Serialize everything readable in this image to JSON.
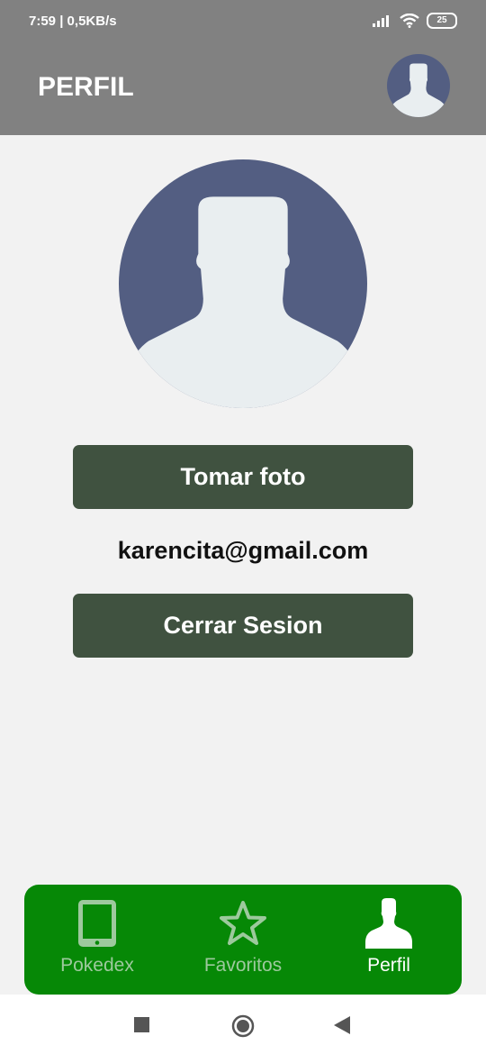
{
  "status_bar": {
    "time_speed": "7:59 | 0,5KB/s",
    "battery_level": "25"
  },
  "header": {
    "title": "PERFIL",
    "avatar_icon": "user-avatar-icon"
  },
  "profile": {
    "avatar_icon": "user-avatar-icon",
    "take_photo_label": "Tomar foto",
    "email": "karencita@gmail.com",
    "logout_label": "Cerrar Sesion"
  },
  "bottom_nav": {
    "items": [
      {
        "label": "Pokedex",
        "icon": "tablet-icon",
        "active": false
      },
      {
        "label": "Favoritos",
        "icon": "star-icon",
        "active": false
      },
      {
        "label": "Perfil",
        "icon": "person-icon",
        "active": true
      }
    ]
  },
  "colors": {
    "app_bar": "#818181",
    "button": "#405240",
    "bottom_nav": "#068806",
    "avatar_bg": "#535e82",
    "avatar_figure": "#e9eef0"
  }
}
